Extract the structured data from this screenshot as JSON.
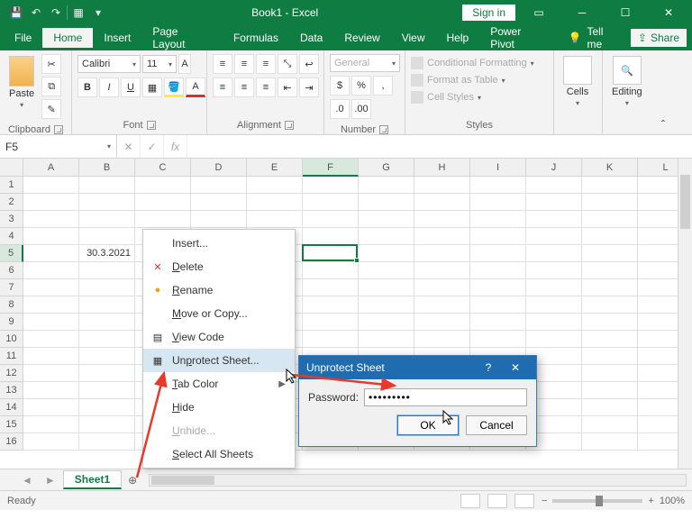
{
  "titlebar": {
    "title": "Book1 - Excel",
    "signin": "Sign in"
  },
  "tabs": {
    "file": "File",
    "home": "Home",
    "insert": "Insert",
    "pagelayout": "Page Layout",
    "formulas": "Formulas",
    "data": "Data",
    "review": "Review",
    "view": "View",
    "help": "Help",
    "powerpivot": "Power Pivot",
    "tellme": "Tell me",
    "share": "Share"
  },
  "ribbon": {
    "clipboard": {
      "paste": "Paste",
      "label": "Clipboard"
    },
    "font": {
      "name": "Calibri",
      "size": "11",
      "label": "Font"
    },
    "alignment": {
      "label": "Alignment"
    },
    "number": {
      "format": "General",
      "label": "Number"
    },
    "styles": {
      "condfmt": "Conditional Formatting",
      "table": "Format as Table",
      "cellstyles": "Cell Styles",
      "label": "Styles"
    },
    "cells": {
      "label": "Cells",
      "btn": "Cells"
    },
    "editing": {
      "label": "Editing",
      "btn": "Editing"
    }
  },
  "namebox": "F5",
  "fx_label": "fx",
  "columns": [
    "A",
    "B",
    "C",
    "D",
    "E",
    "F",
    "G",
    "H",
    "I",
    "J",
    "K",
    "L"
  ],
  "rows": [
    "1",
    "2",
    "3",
    "4",
    "5",
    "6",
    "7",
    "8",
    "9",
    "10",
    "11",
    "12",
    "13",
    "14",
    "15",
    "16"
  ],
  "active_col_index": 5,
  "active_row_index": 4,
  "cell_B5": "30.3.2021",
  "sheet": {
    "name": "Sheet1"
  },
  "context_menu": {
    "insert": "Insert...",
    "delete": "Delete",
    "rename": "Rename",
    "movecopy": "Move or Copy...",
    "viewcode": "View Code",
    "unprotect": "Unprotect Sheet...",
    "tabcolor": "Tab Color",
    "hide": "Hide",
    "unhide": "Unhide...",
    "selectall": "Select All Sheets"
  },
  "dialog": {
    "title": "Unprotect Sheet",
    "password_label": "Password:",
    "password_value": "•••••••••",
    "ok": "OK",
    "cancel": "Cancel"
  },
  "status": {
    "ready": "Ready",
    "zoom": "100%"
  }
}
